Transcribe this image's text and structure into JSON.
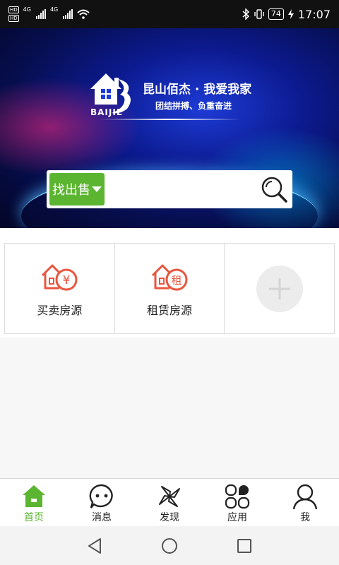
{
  "status_bar": {
    "hd1": "HD",
    "hd2": "HD",
    "net1": "4G",
    "net2": "4G",
    "battery": "74",
    "time": "17:07"
  },
  "banner": {
    "logo_text": "BAIJIE",
    "title": "昆山佰杰 · 我爱我家",
    "subtitle": "团结拼搏、负重奋进"
  },
  "search": {
    "type_label": "找出售",
    "value": "",
    "placeholder": ""
  },
  "grid": {
    "items": [
      {
        "label": "买卖房源",
        "icon": "house-yuan-icon"
      },
      {
        "label": "租赁房源",
        "icon": "house-rent-icon"
      },
      {
        "label": "",
        "icon": "add-icon"
      }
    ],
    "icon_badge_yuan": "¥",
    "icon_badge_rent": "租"
  },
  "tabbar": {
    "items": [
      {
        "label": "首页",
        "icon": "home-icon",
        "active": true
      },
      {
        "label": "消息",
        "icon": "message-icon",
        "active": false
      },
      {
        "label": "发现",
        "icon": "discover-icon",
        "active": false
      },
      {
        "label": "应用",
        "icon": "apps-icon",
        "active": false
      },
      {
        "label": "我",
        "icon": "profile-icon",
        "active": false
      }
    ]
  },
  "colors": {
    "accent": "#5cb531",
    "icon_red": "#e8563f",
    "status_bar": "#111111"
  }
}
